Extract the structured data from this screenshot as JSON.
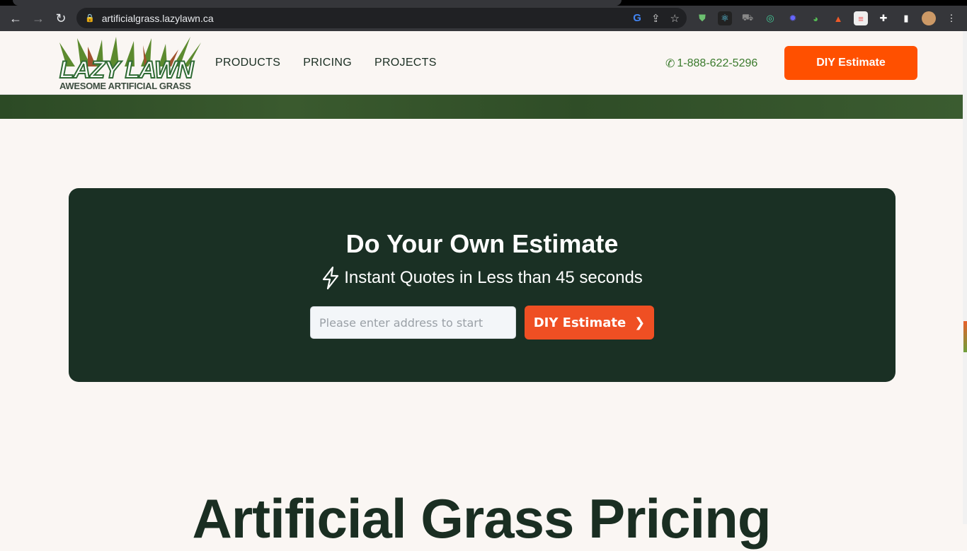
{
  "browser": {
    "url": "artificialgrass.lazylawn.ca",
    "extensions": [
      "adguard-icon",
      "react-devtools-icon",
      "truck-icon",
      "target-icon",
      "gear-star-icon",
      "globe-icon",
      "lighthouse-icon",
      "notes-icon",
      "puzzle-icon",
      "sidepanel-icon"
    ]
  },
  "header": {
    "logo_text": "LAZY LAWN",
    "logo_tagline": "AWESOME ARTIFICIAL GRASS",
    "nav": [
      "PRODUCTS",
      "PRICING",
      "PROJECTS"
    ],
    "phone": "1-888-622-5296",
    "cta": "DIY Estimate"
  },
  "estimate": {
    "title": "Do Your Own Estimate",
    "subtitle": "Instant Quotes in Less than 45 seconds",
    "placeholder": "Please enter address to start",
    "button": "DIY Estimate"
  },
  "section_title": "Artificial Grass Pricing",
  "colors": {
    "accent": "#ff5000",
    "card_bg": "#1a3024",
    "phone": "#3a7a2c"
  }
}
